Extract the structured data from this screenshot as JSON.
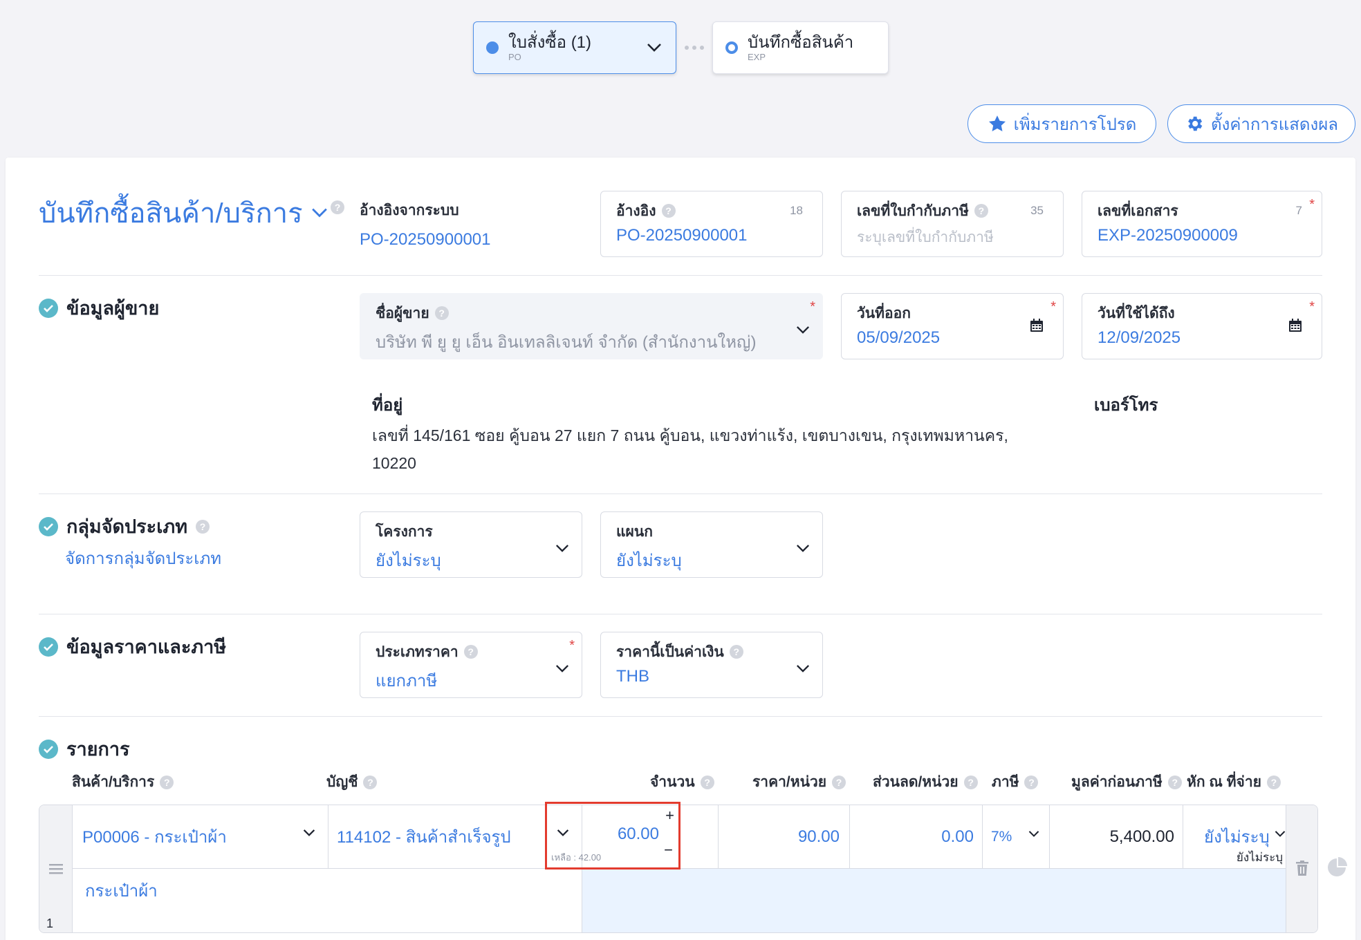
{
  "flow": {
    "current": {
      "title": "ใบสั่งซื้อ (1)",
      "sub": "PO"
    },
    "next": {
      "title": "บันทึกซื้อสินค้า",
      "sub": "EXP"
    }
  },
  "actions": {
    "favorite_label": "เพิ่มรายการโปรด",
    "settings_label": "ตั้งค่าการแสดงผล"
  },
  "header": {
    "title": "บันทึกซื้อสินค้า/บริการ",
    "ref_system_label": "อ้างอิงจากระบบ",
    "ref_system_value": "PO-20250900001",
    "reference": {
      "label": "อ้างอิง",
      "value": "PO-20250900001",
      "counter": "18"
    },
    "tax_invoice": {
      "label": "เลขที่ใบกำกับภาษี",
      "placeholder": "ระบุเลขที่ใบกำกับภาษี",
      "counter": "35"
    },
    "doc_no": {
      "label": "เลขที่เอกสาร",
      "value": "EXP-20250900009",
      "counter": "7",
      "required": "*"
    }
  },
  "vendor": {
    "section_title": "ข้อมูลผู้ขาย",
    "name_label": "ชื่อผู้ขาย",
    "name_value": "บริษัท พี ยู ยู เอ็น อินเทลลิเจนท์ จำกัด (สำนักงานใหญ่)",
    "issue_date_label": "วันที่ออก",
    "issue_date": "05/09/2025",
    "valid_until_label": "วันที่ใช้ได้ถึง",
    "valid_until": "12/09/2025",
    "address_label": "ที่อยู่",
    "address": "เลขที่ 145/161 ซอย คู้บอน 27 แยก 7 ถนน คู้บอน, แขวงท่าแร้ง, เขตบางเขน, กรุงเทพมหานคร, 10220",
    "phone_label": "เบอร์โทร",
    "required": "*"
  },
  "classification": {
    "section_title": "กลุ่มจัดประเภท",
    "manage_link": "จัดการกลุ่มจัดประเภท",
    "project_label": "โครงการ",
    "project_value": "ยังไม่ระบุ",
    "department_label": "แผนก",
    "department_value": "ยังไม่ระบุ"
  },
  "pricing": {
    "section_title": "ข้อมูลราคาและภาษี",
    "price_type_label": "ประเภทราคา",
    "price_type_value": "แยกภาษี",
    "currency_label": "ราคานี้เป็นค่าเงิน",
    "currency_value": "THB",
    "required": "*"
  },
  "items": {
    "section_title": "รายการ",
    "columns": {
      "product": "สินค้า/บริการ",
      "account": "บัญชี",
      "qty": "จำนวน",
      "unit_price": "ราคา/หน่วย",
      "discount": "ส่วนลด/หน่วย",
      "tax": "ภาษี",
      "pre_tax": "มูลค่าก่อนภาษี",
      "wht": "หัก ณ ที่จ่าย"
    },
    "rows": [
      {
        "no": "1",
        "product": "P00006 - กระเป๋าผ้า",
        "account": "114102 - สินค้าสำเร็จรูป",
        "qty": "60.00",
        "remaining": "เหลือ : 42.00",
        "plus": "+",
        "minus": "−",
        "unit_price": "90.00",
        "discount": "0.00",
        "tax": "7%",
        "pre_tax": "5,400.00",
        "wht": "ยังไม่ระบุ",
        "wht_sub": "ยังไม่ระบุ",
        "description": "กระเป๋าผ้า"
      }
    ]
  },
  "colors": {
    "accent": "#3b7be0",
    "check": "#5bb8c9",
    "highlight": "#e33b2e",
    "required": "#e04444"
  },
  "icons": [
    "chevron-down-icon",
    "star-icon",
    "gear-icon",
    "help-icon",
    "calendar-icon",
    "check-circle-icon",
    "drag-handle-icon",
    "trash-icon",
    "pie-chart-icon"
  ]
}
